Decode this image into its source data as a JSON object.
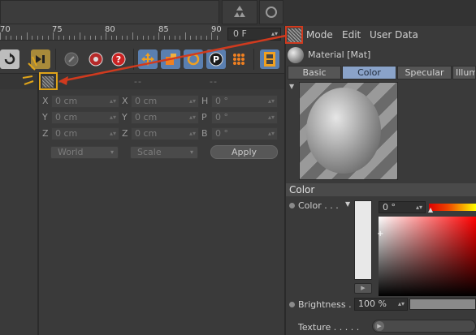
{
  "timeline": {
    "ruler_labels": [
      "70",
      "75",
      "80",
      "85",
      "90"
    ],
    "frame_value": "0 F"
  },
  "menu": {
    "items": [
      "Mode",
      "Edit",
      "User Data"
    ]
  },
  "material": {
    "name": "Material [Mat]",
    "tabs": [
      "Basic",
      "Color",
      "Specular",
      "Illum"
    ],
    "active_tab": "Color"
  },
  "coords": {
    "header_dashes": [
      "--",
      "--",
      "--"
    ],
    "rows": [
      {
        "l1": "X",
        "v1": "0 cm",
        "l2": "X",
        "v2": "0 cm",
        "l3": "H",
        "v3": "0 °"
      },
      {
        "l1": "Y",
        "v1": "0 cm",
        "l2": "Y",
        "v2": "0 cm",
        "l3": "P",
        "v3": "0 °"
      },
      {
        "l1": "Z",
        "v1": "0 cm",
        "l2": "Z",
        "v2": "0 cm",
        "l3": "B",
        "v3": "0 °"
      }
    ],
    "space_select": "World",
    "mode_select": "Scale",
    "apply_label": "Apply"
  },
  "color_panel": {
    "section_title": "Color",
    "color_label": "Color . . .",
    "hue_value": "0 °",
    "brightness_label": "Brightness . .",
    "brightness_value": "100 %",
    "texture_label": "Texture . . . . ."
  },
  "colors": {
    "highlight_box": "#e0a41a",
    "arrow": "#d03a1e",
    "active_tab": "#8aa3c9"
  },
  "icons": {
    "toolbar": [
      "loop-icon",
      "goto-end-icon",
      "record-keys-icon",
      "autokey-icon",
      "help-icon",
      "move-icon",
      "scale-icon",
      "rotate-icon",
      "param-icon",
      "points-icon",
      "filmstrip-icon"
    ]
  }
}
